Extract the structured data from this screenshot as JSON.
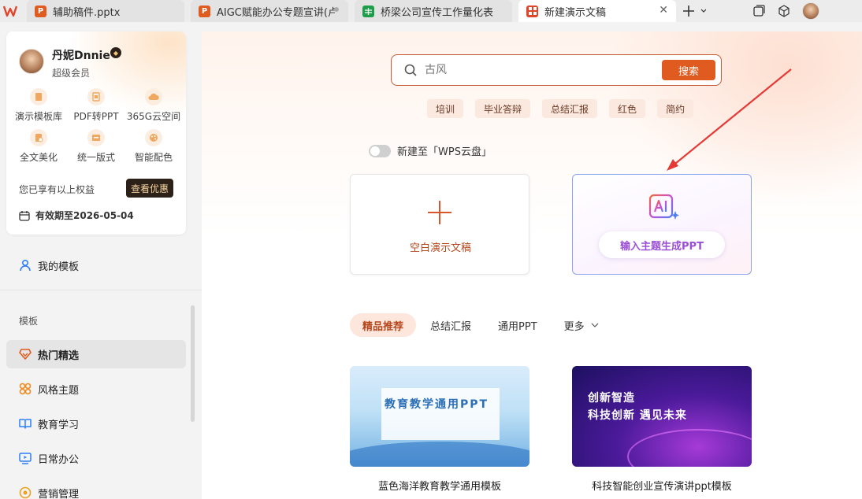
{
  "tabs": [
    {
      "title": "辅助稿件.pptx",
      "icon": "P",
      "color": "#e05b20",
      "active": false
    },
    {
      "title": "AIGC赋能办公专题宣讲(卢",
      "icon": "P",
      "color": "#e05b20",
      "active": false
    },
    {
      "title": "桥梁公司宣传工作量化表",
      "icon": "S",
      "color": "#1e9e4a",
      "active": false
    },
    {
      "title": "新建演示文稿",
      "icon": "",
      "color": "#e0452a",
      "active": true
    }
  ],
  "user": {
    "name": "丹妮Dnnie",
    "level": "超级会员",
    "perks": [
      "演示模板库",
      "PDF转PPT",
      "365G云空间",
      "全文美化",
      "统一版式",
      "智能配色"
    ],
    "rights_text": "您已享有以上权益",
    "view_offer": "查看优惠",
    "expire": "有效期至2026-05-04"
  },
  "nav": {
    "my_templates": "我的模板",
    "section_label": "模板",
    "items": [
      "热门精选",
      "风格主题",
      "教育学习",
      "日常办公",
      "营销管理"
    ]
  },
  "search": {
    "placeholder": "古风",
    "button": "搜索"
  },
  "tags": [
    "培训",
    "毕业答辩",
    "总结汇报",
    "红色",
    "简约"
  ],
  "cloud_toggle": "新建至「WPS云盘」",
  "cards": {
    "blank": "空白演示文稿",
    "ai": "输入主题生成PPT"
  },
  "categories": [
    "精品推荐",
    "总结汇报",
    "通用PPT",
    "更多"
  ],
  "templates": [
    {
      "thumb_title": "教育教学通用PPT",
      "label": "蓝色海洋教育教学通用模板"
    },
    {
      "thumb_line1": "创新智造",
      "thumb_line2": "科技创新 遇见未来",
      "label": "科技智能创业宣传演讲ppt模板"
    }
  ],
  "colors": {
    "accent": "#e05b20",
    "annotation_arrow": "#e53935"
  }
}
